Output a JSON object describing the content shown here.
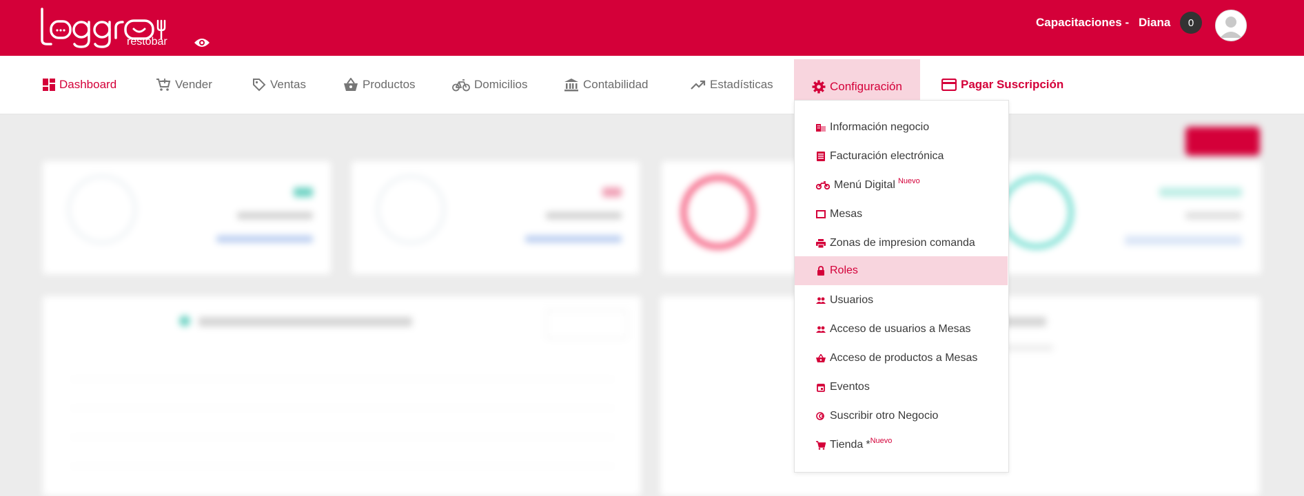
{
  "brand": {
    "logo_text": "loggro",
    "logo_sub": "restobar"
  },
  "header": {
    "company": "Capacitaciones -",
    "user": "Diana",
    "notification_count": "0",
    "color": "#d40039"
  },
  "nav": {
    "items": [
      {
        "label": "Dashboard",
        "icon": "dashboard-icon"
      },
      {
        "label": "Vender",
        "icon": "cart-add-icon"
      },
      {
        "label": "Ventas",
        "icon": "tag-icon"
      },
      {
        "label": "Productos",
        "icon": "basket-icon"
      },
      {
        "label": "Domicilios",
        "icon": "bicycle-icon"
      },
      {
        "label": "Contabilidad",
        "icon": "bank-icon"
      },
      {
        "label": "Estadísticas",
        "icon": "trending-icon"
      },
      {
        "label": "Configuración",
        "icon": "gear-icon"
      },
      {
        "label": "Pagar Suscripción",
        "icon": "credit-card-icon"
      }
    ]
  },
  "config_menu": {
    "items": [
      {
        "label": "Información negocio",
        "icon": "building-icon"
      },
      {
        "label": "Facturación electrónica",
        "icon": "receipt-icon"
      },
      {
        "label": "Menú Digital",
        "icon": "motorcycle-icon",
        "tag": "Nuevo"
      },
      {
        "label": "Mesas",
        "icon": "table-icon"
      },
      {
        "label": "Zonas de impresion comanda",
        "icon": "printer-icon"
      },
      {
        "label": "Roles",
        "icon": "lock-icon"
      },
      {
        "label": "Usuarios",
        "icon": "people-icon"
      },
      {
        "label": "Acceso de usuarios a Mesas",
        "icon": "people-icon"
      },
      {
        "label": "Acceso de productos a Mesas",
        "icon": "basket-icon"
      },
      {
        "label": "Eventos",
        "icon": "calendar-icon"
      },
      {
        "label": "Suscribir otro Negocio",
        "icon": "subscribe-icon"
      },
      {
        "label": "Tienda",
        "icon": "cart-icon",
        "prefix": "*",
        "tag": "Nuevo"
      }
    ],
    "highlighted": "Roles"
  }
}
